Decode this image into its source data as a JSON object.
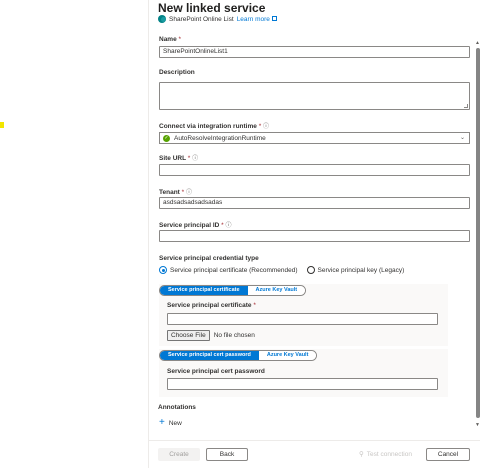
{
  "header": {
    "title": "New linked service",
    "service_name": "SharePoint Online List",
    "learn_more": "Learn more"
  },
  "name_field": {
    "label": "Name",
    "required": "*",
    "value": "SharePointOnlineList1"
  },
  "description_field": {
    "label": "Description",
    "value": ""
  },
  "runtime_field": {
    "label": "Connect via integration runtime",
    "required": "*",
    "info": "ⓘ",
    "value": "AutoResolveIntegrationRuntime"
  },
  "site_url_field": {
    "label": "Site URL",
    "required": "*",
    "info": "ⓘ",
    "value": ""
  },
  "tenant_field": {
    "label": "Tenant",
    "required": "*",
    "info": "ⓘ",
    "value": "asdsadsadsadsadas"
  },
  "principal_id_field": {
    "label": "Service principal ID",
    "required": "*",
    "info": "ⓘ",
    "value": ""
  },
  "credential_type": {
    "label": "Service principal credential type",
    "options": [
      "Service principal certificate (Recommended)",
      "Service principal key (Legacy)"
    ],
    "selected": 0
  },
  "certificate_toggle": {
    "options": [
      "Service principal certificate",
      "Azure Key Vault"
    ],
    "selected": 0
  },
  "certificate_field": {
    "label": "Service principal certificate",
    "required": "*",
    "button": "Choose File",
    "status": "No file chosen"
  },
  "password_toggle": {
    "options": [
      "Service principal cert password",
      "Azure Key Vault"
    ],
    "selected": 0
  },
  "password_field": {
    "label": "Service principal cert password",
    "value": ""
  },
  "annotations": {
    "label": "Annotations",
    "new_label": "New"
  },
  "footer": {
    "create": "Create",
    "back": "Back",
    "test_connection": "Test connection",
    "cancel": "Cancel"
  },
  "colors": {
    "accent": "#0078d4",
    "success": "#57a300",
    "required": "#a4262c"
  }
}
